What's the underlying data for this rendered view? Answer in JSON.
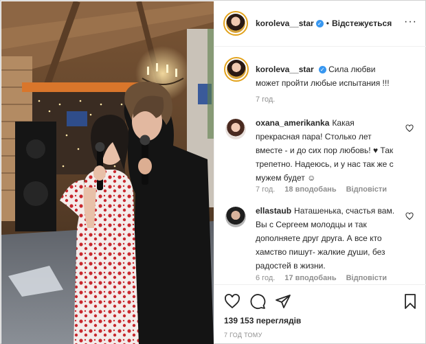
{
  "post": {
    "username": "koroleva__star",
    "verified": true,
    "follow_state": "Відстежується",
    "more_icon": "more-options-icon"
  },
  "caption": {
    "username": "koroleva__star",
    "text": "Сила любви может пройти любые испытания !!!",
    "time": "7 год."
  },
  "comments": [
    {
      "username": "oxana_amerikanka",
      "text": "Какая прекрасная пара! Столько лет вместе - и до сих пор любовь! ♥ Так трепетно. Надеюсь, и у нас так же с мужем будет ☺",
      "time": "7 год.",
      "likes": "18 вподобань",
      "reply": "Відповісти"
    },
    {
      "username": "ellastaub",
      "text": "Наташенька, счастья вам. Вы с Сергеем молодцы и так дополняете друг друга. А все кто хамство пишут- жалкие души, без радостей в жизни.",
      "time": "6 год.",
      "likes": "17 вподобань",
      "reply": "Відповісти"
    }
  ],
  "stats": {
    "views": "139 153 переглядів",
    "posted": "7 ГОД ТОМУ"
  },
  "colors": {
    "verified": "#3897f0",
    "story_ring": "#e2a21b",
    "muted": "#8e8e8e",
    "text": "#262626"
  }
}
